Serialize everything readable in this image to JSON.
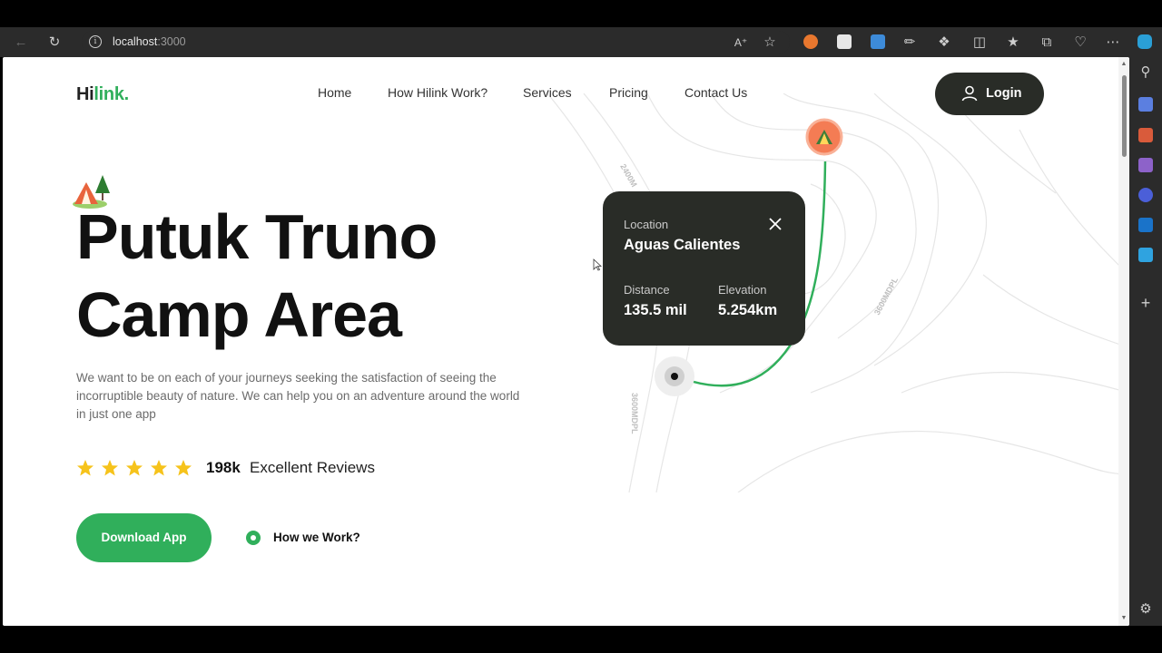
{
  "browser": {
    "url_host": "localhost",
    "url_port": ":3000"
  },
  "nav": {
    "logo_main": "Hi",
    "logo_accent": "link.",
    "links": [
      "Home",
      "How Hilink Work?",
      "Services",
      "Pricing",
      "Contact Us"
    ],
    "login_label": "Login"
  },
  "hero": {
    "title_line1": "Putuk Truno",
    "title_line2": "Camp Area",
    "description": "We want to be on each of your journeys seeking the satisfaction of seeing the incorruptible beauty of nature. We can help you on an adventure around the world in just one app",
    "rating_stars": 5,
    "reviews_count": "198k",
    "reviews_label": "Excellent Reviews",
    "download_label": "Download App",
    "how_label": "How we Work?"
  },
  "location_card": {
    "location_caption": "Location",
    "location_name": "Aguas Calientes",
    "distance_caption": "Distance",
    "distance_value": "135.5 mil",
    "elevation_caption": "Elevation",
    "elevation_value": "5.254km"
  },
  "map": {
    "contour_labels": [
      "2400M",
      "3600MDPL",
      "3600MDPL"
    ]
  },
  "colors": {
    "brand_green": "#30af5b",
    "dark": "#292c27",
    "pin_orange": "#f47c54",
    "star_yellow": "#f6c31b"
  }
}
